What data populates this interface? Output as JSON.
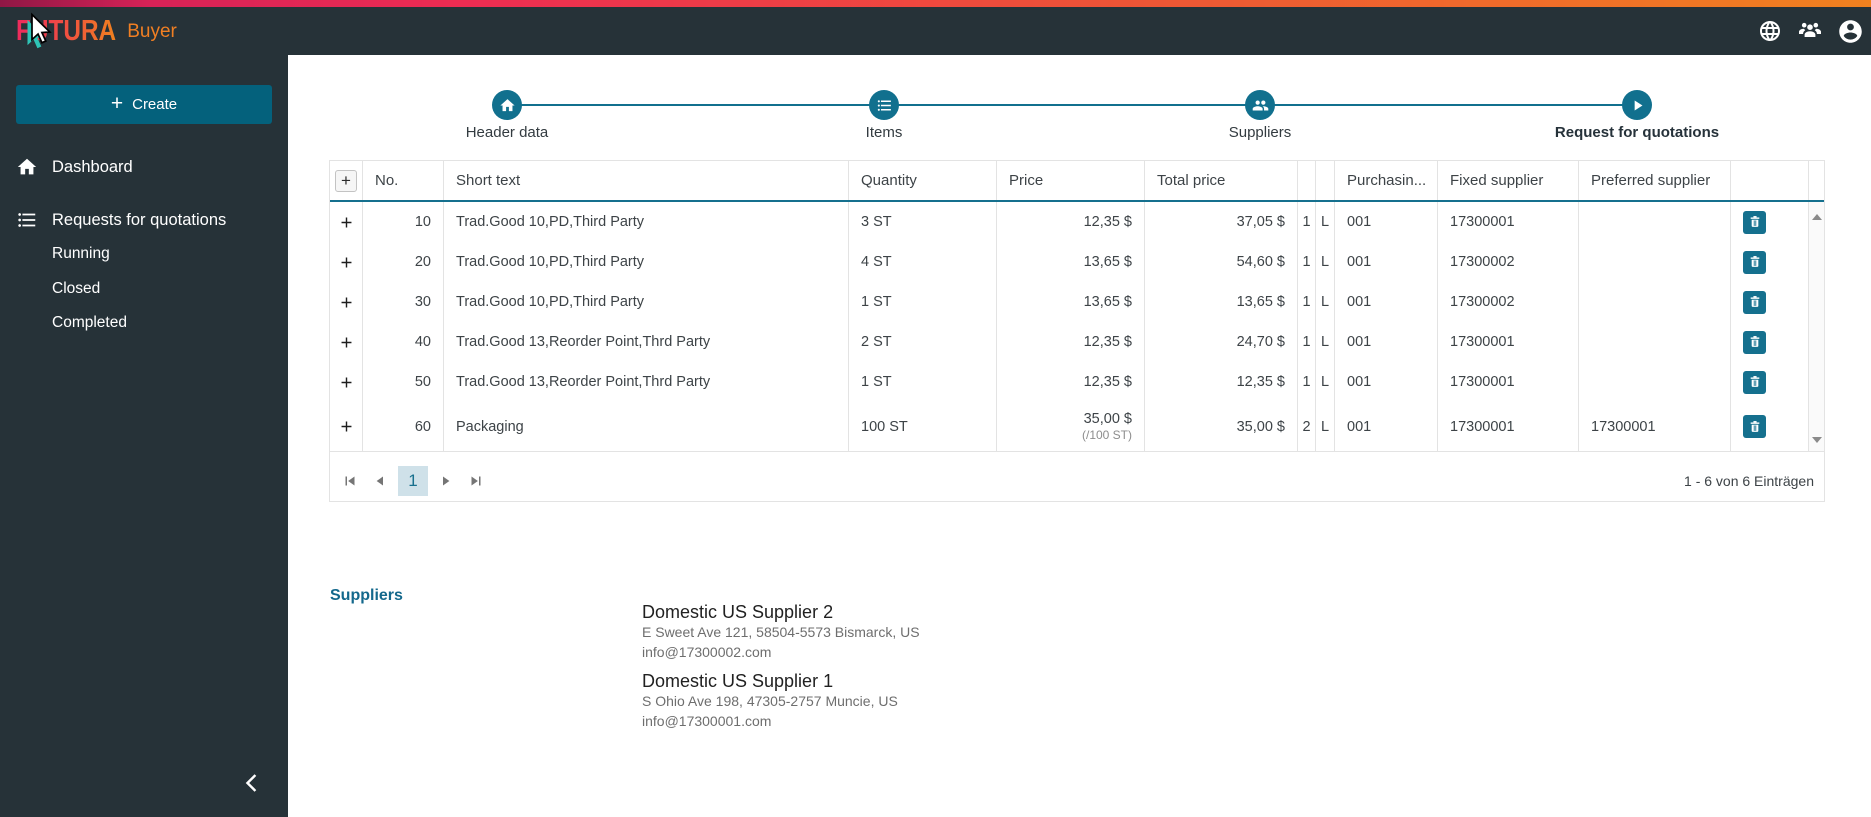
{
  "brand": {
    "name": "FUTURA",
    "suffix": "Buyer"
  },
  "sidebar": {
    "create_button": "Create",
    "nav": [
      {
        "label": "Dashboard",
        "icon": "home"
      },
      {
        "label": "Requests for quotations",
        "icon": "list"
      }
    ],
    "subnav": [
      "Running",
      "Closed",
      "Completed"
    ]
  },
  "stepper": {
    "steps": [
      {
        "label": "Header data",
        "icon": "home",
        "active": false
      },
      {
        "label": "Items",
        "icon": "list",
        "active": false
      },
      {
        "label": "Suppliers",
        "icon": "people",
        "active": false
      },
      {
        "label": "Request for quotations",
        "icon": "play",
        "active": true
      }
    ]
  },
  "items_table": {
    "columns": [
      "",
      "No.",
      "Short text",
      "Quantity",
      "Price",
      "Total price",
      "",
      "",
      "Purchasin...",
      "Fixed supplier",
      "Preferred supplier",
      "",
      ""
    ],
    "rows": [
      {
        "no": "10",
        "short_text": "Trad.Good 10,PD,Third Party",
        "quantity": "3 ST",
        "price": "12,35 $",
        "price_note": "",
        "total_price": "37,05 $",
        "narrow1": "1",
        "narrow2": "L",
        "purchasing": "001",
        "fixed_supplier": "17300001",
        "preferred_supplier": ""
      },
      {
        "no": "20",
        "short_text": "Trad.Good 10,PD,Third Party",
        "quantity": "4 ST",
        "price": "13,65 $",
        "price_note": "",
        "total_price": "54,60 $",
        "narrow1": "1",
        "narrow2": "L",
        "purchasing": "001",
        "fixed_supplier": "17300002",
        "preferred_supplier": ""
      },
      {
        "no": "30",
        "short_text": "Trad.Good 10,PD,Third Party",
        "quantity": "1 ST",
        "price": "13,65 $",
        "price_note": "",
        "total_price": "13,65 $",
        "narrow1": "1",
        "narrow2": "L",
        "purchasing": "001",
        "fixed_supplier": "17300002",
        "preferred_supplier": ""
      },
      {
        "no": "40",
        "short_text": "Trad.Good 13,Reorder Point,Thrd Party",
        "quantity": "2 ST",
        "price": "12,35 $",
        "price_note": "",
        "total_price": "24,70 $",
        "narrow1": "1",
        "narrow2": "L",
        "purchasing": "001",
        "fixed_supplier": "17300001",
        "preferred_supplier": ""
      },
      {
        "no": "50",
        "short_text": "Trad.Good 13,Reorder Point,Thrd Party",
        "quantity": "1 ST",
        "price": "12,35 $",
        "price_note": "",
        "total_price": "12,35 $",
        "narrow1": "1",
        "narrow2": "L",
        "purchasing": "001",
        "fixed_supplier": "17300001",
        "preferred_supplier": ""
      },
      {
        "no": "60",
        "short_text": "Packaging",
        "quantity": "100 ST",
        "price": "35,00 $",
        "price_note": "(/100 ST)",
        "total_price": "35,00 $",
        "narrow1": "2",
        "narrow2": "L",
        "purchasing": "001",
        "fixed_supplier": "17300001",
        "preferred_supplier": "17300001"
      }
    ],
    "pagination": {
      "current_page": "1",
      "summary": "1 - 6 von 6 Einträgen"
    }
  },
  "suppliers_section": {
    "heading": "Suppliers",
    "entries": [
      {
        "name": "Domestic US Supplier 2",
        "address": "E Sweet Ave 121, 58504-5573 Bismarck, US",
        "email": "info@17300002.com"
      },
      {
        "name": "Domestic US Supplier 1",
        "address": "S Ohio Ave 198, 47305-2757 Muncie, US",
        "email": "info@17300001.com"
      }
    ]
  },
  "colors": {
    "dark": "#263238",
    "accent_teal": "#11708e",
    "create_button": "#04617c",
    "gradient_left": "#8f1745",
    "gradient_mid": "#ee2c52",
    "gradient_right": "#f0811f",
    "page_box_bg": "#cfe1e9"
  }
}
